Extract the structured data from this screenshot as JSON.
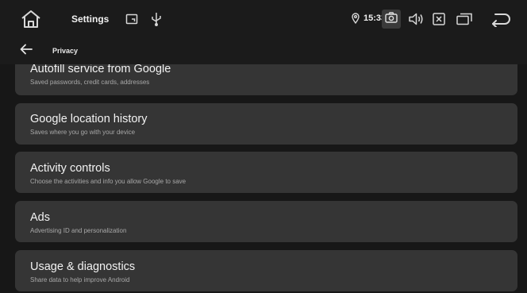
{
  "status_bar": {
    "title": "Settings",
    "time": "15:33",
    "icons": [
      "home-icon",
      "cast-icon",
      "usb-icon",
      "location-icon",
      "camera-icon",
      "volume-icon",
      "close-box-icon",
      "recents-icon",
      "back-icon"
    ]
  },
  "app_bar": {
    "title": "Privacy"
  },
  "items": [
    {
      "title": "Autofill service from Google",
      "subtitle": "Saved passwords, credit cards, addresses"
    },
    {
      "title": "Google location history",
      "subtitle": "Saves where you go with your device"
    },
    {
      "title": "Activity controls",
      "subtitle": "Choose the activities and info you allow Google to save"
    },
    {
      "title": "Ads",
      "subtitle": "Advertising ID and personalization"
    },
    {
      "title": "Usage & diagnostics",
      "subtitle": "Share data to help improve Android"
    }
  ],
  "colors": {
    "background": "#171717",
    "card": "#353535",
    "text_primary": "#f2f2f2",
    "text_secondary": "#a8a8a8"
  }
}
